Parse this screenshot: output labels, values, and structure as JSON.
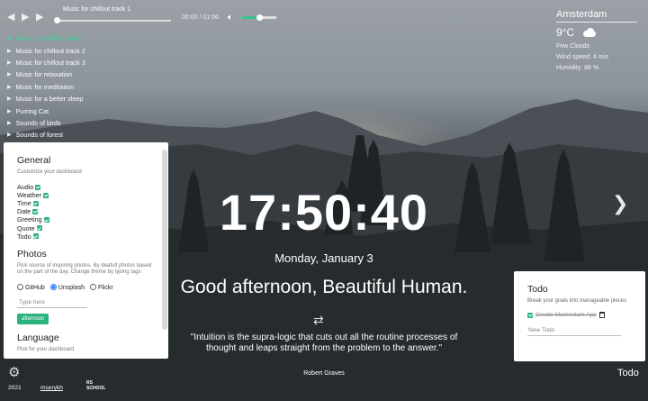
{
  "player": {
    "now_playing": "Music for chillout track 1",
    "time": "00:00 / 01:06",
    "volume_fraction": 0.5,
    "progress_fraction": 0.0,
    "tracks": [
      "Music for chillout track 1",
      "Music for chillout track 2",
      "Music for chillout track 3",
      "Music for relaxation",
      "Music for meditation",
      "Music for a better sleep",
      "Purring Cat",
      "Sounds of birds",
      "Sounds of forest"
    ],
    "active_index": 0,
    "accent": "#44d3a0"
  },
  "weather": {
    "city": "Amsterdam",
    "temp": "9°C",
    "description": "Few Clouds",
    "wind": "Wind speed: 4 m/s",
    "humidity": "Humidity: 88 %"
  },
  "settings": {
    "general_title": "General",
    "general_sub": "Customize your dashboard",
    "toggles": [
      "Audio",
      "Weather",
      "Time",
      "Date",
      "Greeting",
      "Quote",
      "Todo"
    ],
    "photos_title": "Photos",
    "photos_sub": "Pick source of inspiring photos. By deafult photos based on the part of the day. Change theme by typing tags",
    "source_github": "GitHub",
    "source_unsplash": "Unsplash",
    "source_flickr": "Flickr",
    "selected_source": "Unsplash",
    "tags_placeholder": "Type here",
    "tag": "afternoon",
    "language_title": "Language",
    "language_sub": "Pick for your dashboard",
    "accent": "#2bb37f"
  },
  "clock": {
    "time": "17:50:40",
    "date": "Monday, January 3",
    "greeting": "Good afternoon, Beautiful Human."
  },
  "quote": {
    "text": "\"Intuition is the supra-logic that cuts out all the routine processes of thought and leaps straight from the problem to the answer.\"",
    "author": "Robert Graves"
  },
  "todo": {
    "title": "Todo",
    "subtitle": "Break your goals into manageable pieces",
    "items": [
      {
        "text": "Create Momentum App",
        "done": true
      }
    ],
    "new_placeholder": "New Todo",
    "toggle_label": "Todo"
  },
  "footer": {
    "year": "2021",
    "author": "mserykh",
    "logo_text": "RS SCHOOL"
  },
  "icons": {
    "prev": "prev-icon",
    "play": "play-icon",
    "next": "next-icon",
    "volume": "volume-icon",
    "weather": "cloud-icon",
    "refresh": "refresh-icon",
    "slider_next": "chevron-right-icon",
    "settings": "gear-icon",
    "delete": "trash-icon"
  }
}
